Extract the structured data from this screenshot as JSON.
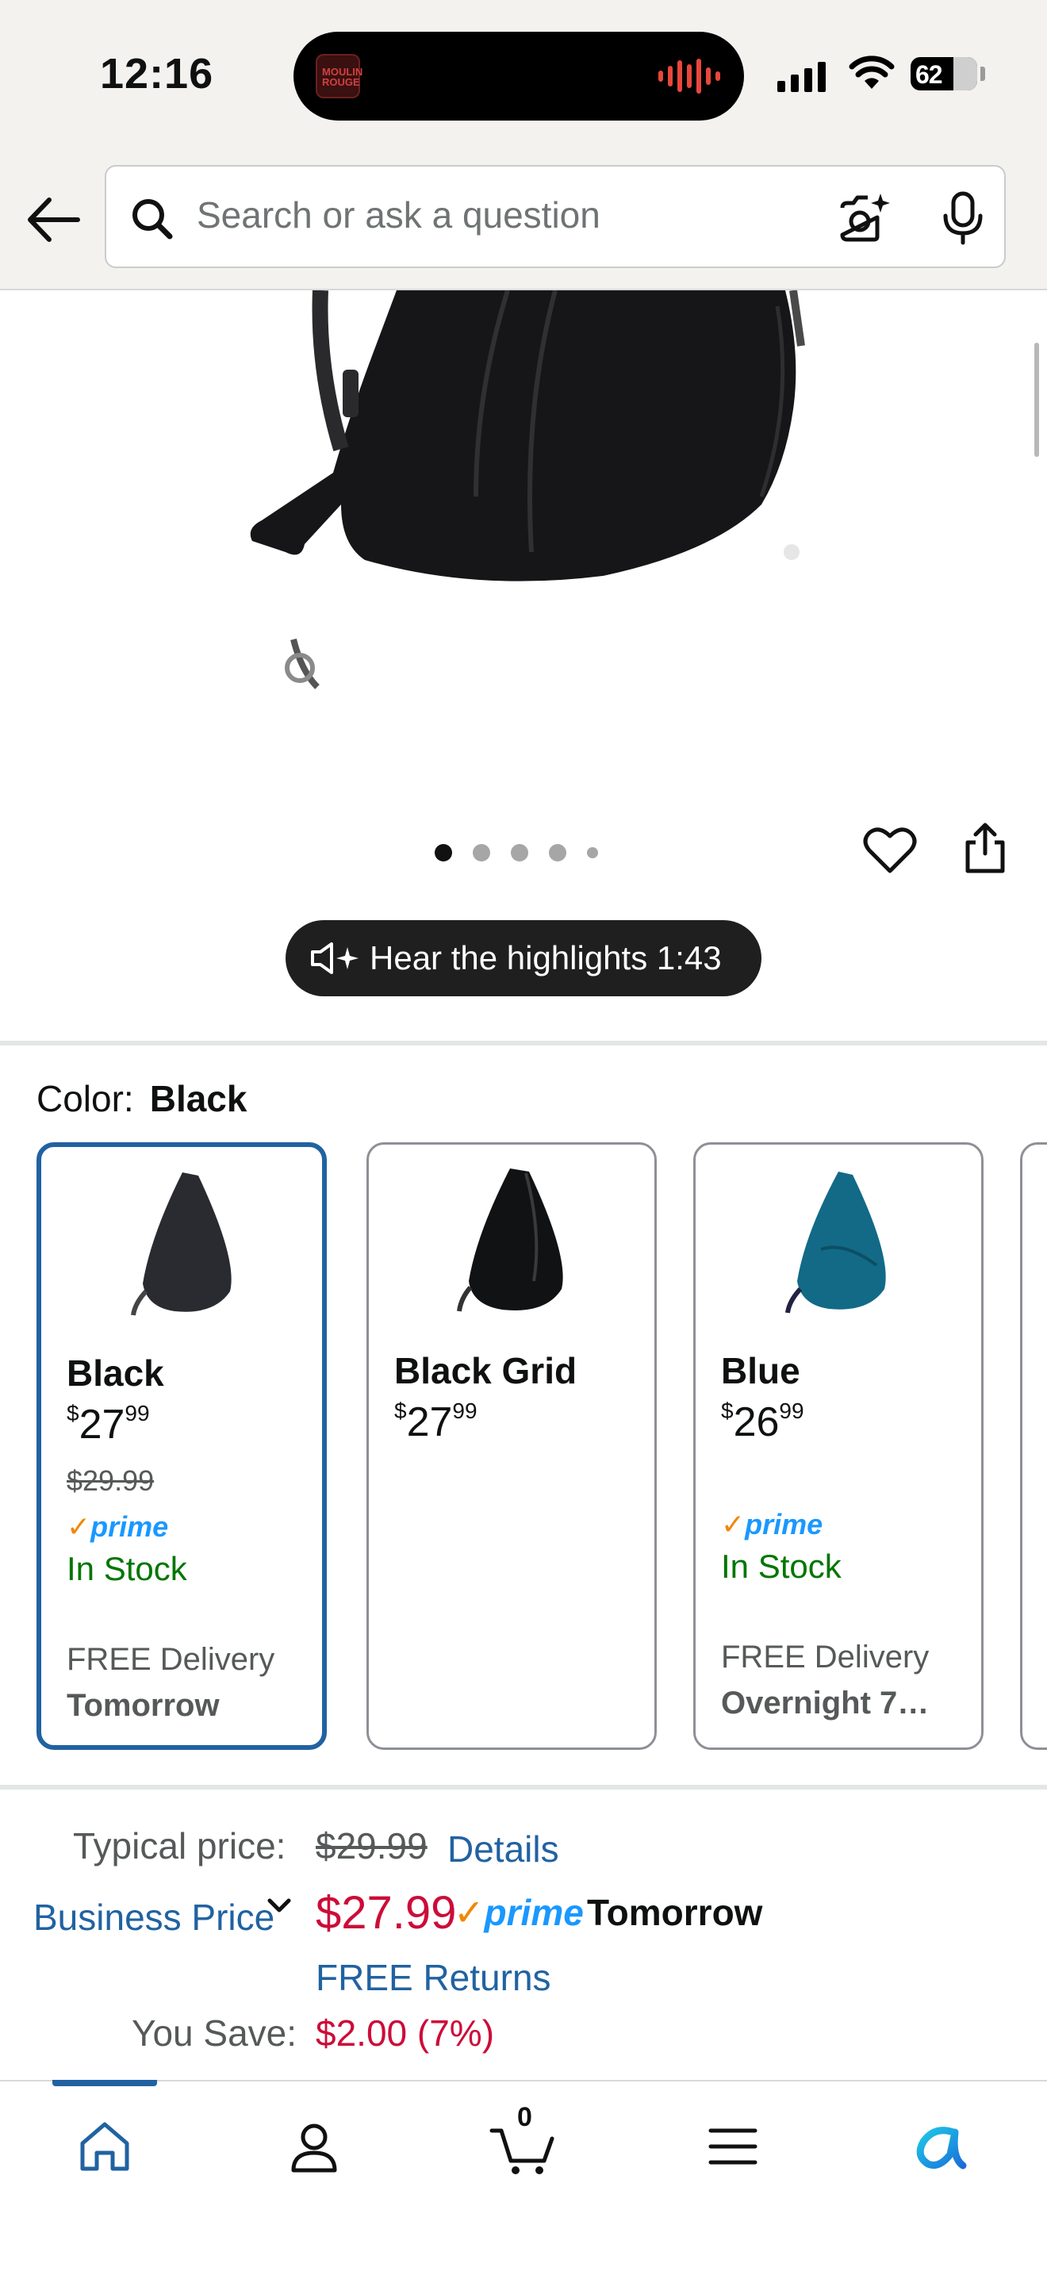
{
  "status_bar": {
    "time": "12:16",
    "battery": "62",
    "island_art_text": "MOULIN ROUGE"
  },
  "search": {
    "placeholder": "Search or ask a question"
  },
  "gallery": {
    "hear_label": "Hear the highlights 1:43"
  },
  "color": {
    "label": "Color:",
    "selected": "Black",
    "swatches": [
      {
        "name": "Black",
        "price_whole": "27",
        "price_fraction": "99",
        "was_price": "$29.99",
        "prime": "prime",
        "stock": "In Stock",
        "delivery_label": "FREE Delivery",
        "delivery_when": "Tomorrow"
      },
      {
        "name": "Black Grid",
        "price_whole": "27",
        "price_fraction": "99"
      },
      {
        "name": "Blue",
        "price_whole": "26",
        "price_fraction": "99",
        "prime": "prime",
        "stock": "In Stock",
        "delivery_label": "FREE Delivery",
        "delivery_when": "Overnight 7…"
      }
    ]
  },
  "pricing": {
    "typical_label": "Typical price:",
    "typical_value": "$29.99",
    "details_link": "Details",
    "business_label": "Business Price",
    "price": "$27.99",
    "prime": "prime",
    "delivery": "Tomorrow",
    "free_returns": "FREE Returns",
    "save_label": "You Save:",
    "save_value": "$2.00 (7%)"
  },
  "nav": {
    "cart_count": "0"
  },
  "colors": {
    "link": "#2162a1",
    "deal": "#cc0c39",
    "instock": "#007600",
    "prime": "#1a98ff"
  }
}
